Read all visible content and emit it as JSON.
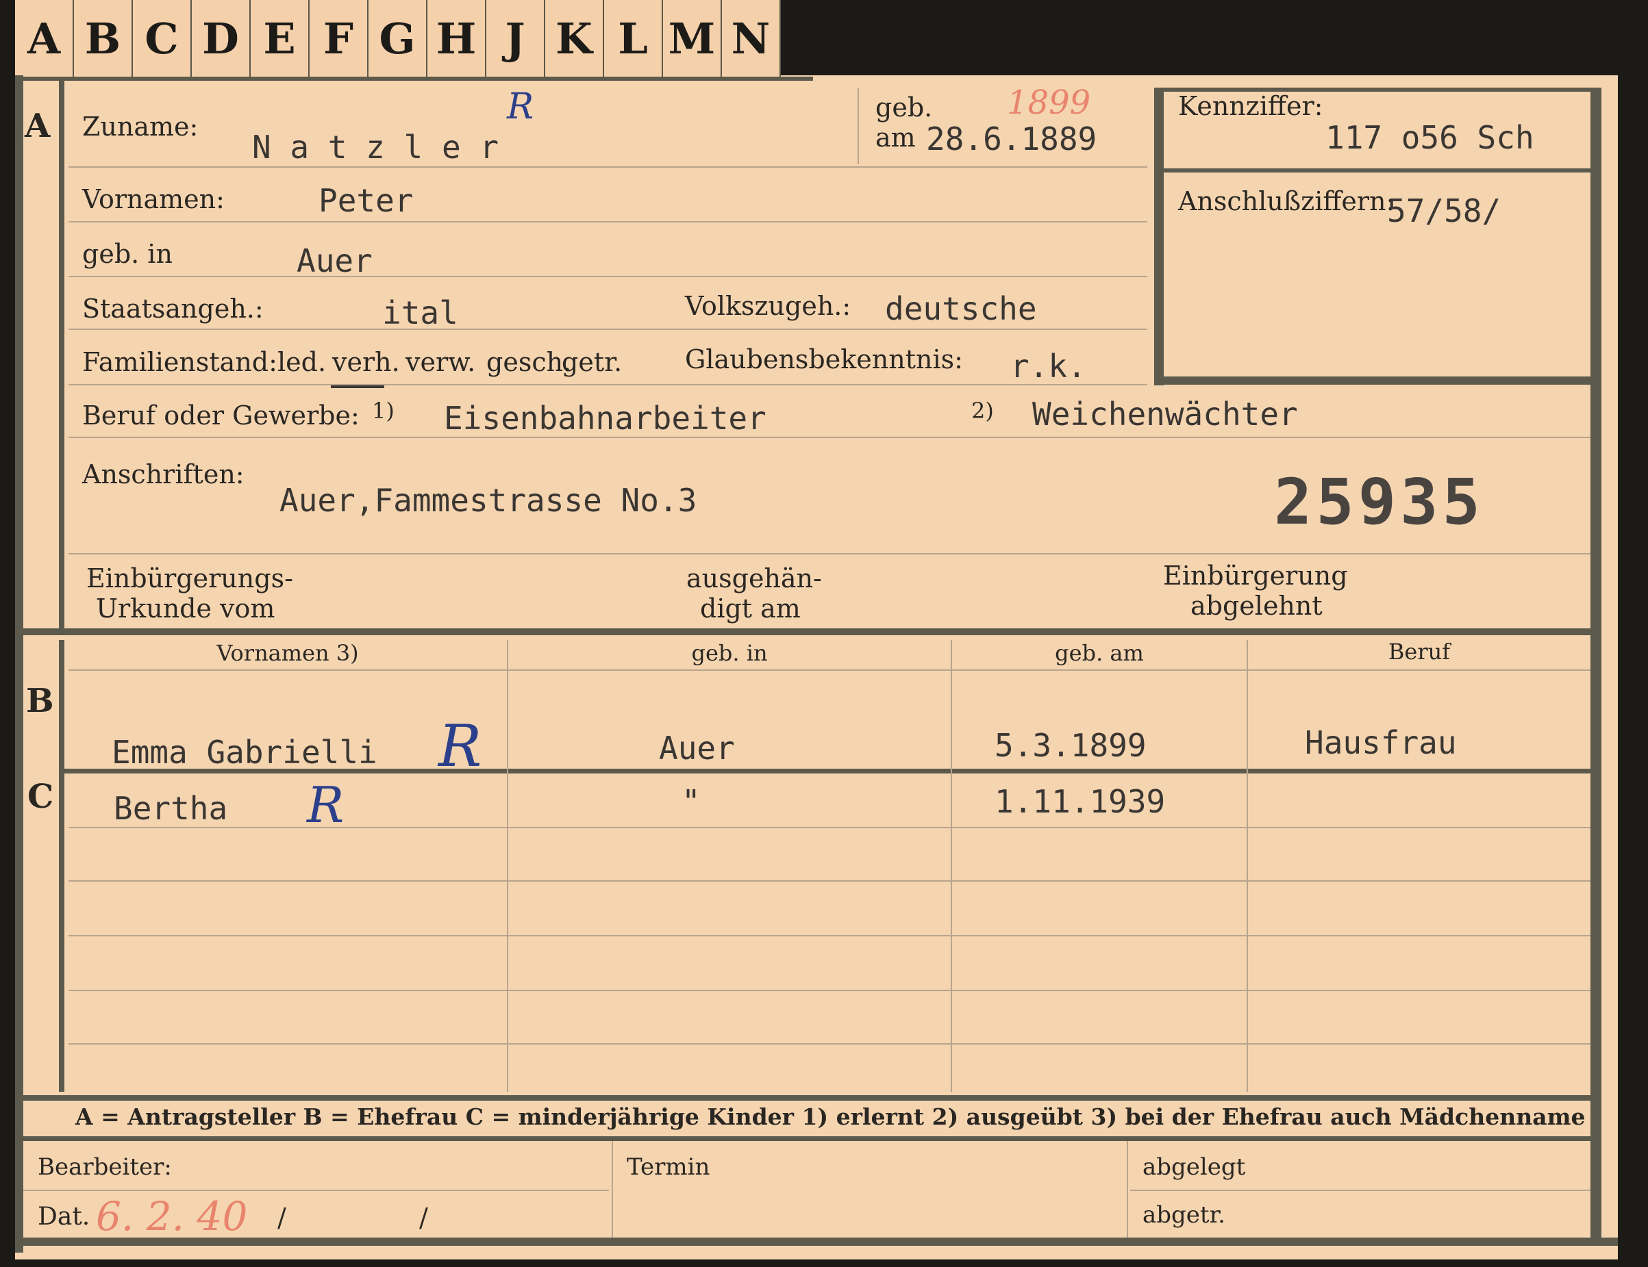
{
  "tabs": [
    "A",
    "B",
    "C",
    "D",
    "E",
    "F",
    "G",
    "H",
    "J",
    "K",
    "L",
    "M",
    "N"
  ],
  "sections": {
    "a": "A",
    "b": "B",
    "c": "C"
  },
  "applicant": {
    "surname_label": "Zuname:",
    "surname_value": "N a t z l e r",
    "born_label_1": "geb.",
    "born_label_2": "am",
    "born_value": "28.6.1889",
    "born_note": "1899",
    "code_label": "Kennziffer:",
    "code_value": "117 o56  Sch",
    "first_label": "Vornamen:",
    "first_value": "Peter",
    "connect_label": "Anschlußziffern:",
    "connect_value": "57/58/",
    "birthplace_label": "geb. in",
    "birthplace_value": "Auer",
    "citizenship_label": "Staatsangeh.:",
    "citizenship_value": "ital",
    "ethnicity_label": "Volkszugeh.:",
    "ethnicity_value": "deutsche",
    "family_label": "Familienstand:",
    "family_options": [
      "led.",
      "verh.",
      "verw.",
      "gesch.",
      "getr."
    ],
    "religion_label": "Glaubensbekenntnis:",
    "religion_value": "r.k.",
    "job_label": "Beruf oder Gewerbe:",
    "job_mark_1": "1)",
    "job_value_1": "Eisenbahnarbeiter",
    "job_mark_2": "2)",
    "job_value_2": "Weichenwächter",
    "address_label": "Anschriften:",
    "address_value": "Auer,Fammestrasse No.3",
    "file_number": "25935",
    "natur_doc_1": "Einbürgerungs-",
    "natur_doc_2": "Urkunde vom",
    "issued_1": "ausgehän-",
    "issued_2": "digt am",
    "denied_1": "Einbürgerung",
    "denied_2": "abgelehnt"
  },
  "family_table": {
    "headers": [
      "Vornamen 3)",
      "geb. in",
      "geb. am",
      "Beruf"
    ],
    "spouse": [
      "Emma  Gabrielli",
      "Auer",
      "5.3.1899",
      "Hausfrau"
    ],
    "children": [
      [
        "Bertha",
        "\"",
        "1.11.1939",
        ""
      ]
    ]
  },
  "marks": {
    "r1": "R",
    "r2": "R",
    "r3": "R"
  },
  "legend": "A = Antragsteller   B = Ehefrau   C = minderjährige Kinder   1) erlernt   2) ausgeübt   3) bei der Ehefrau auch Mädchenname",
  "footer": {
    "worker_label": "Bearbeiter:",
    "deadline_label": "Termin",
    "filed_label": "abgelegt",
    "date_label": "Dat.",
    "date_value": "6. 2. 40",
    "slash": "/",
    "removed_label": "abgetr."
  },
  "colors": {
    "card": "#f5d4b0",
    "rule": "#5b5a4c",
    "ink_blue": "#2c3f8a",
    "ink_red": "#e8846c"
  }
}
